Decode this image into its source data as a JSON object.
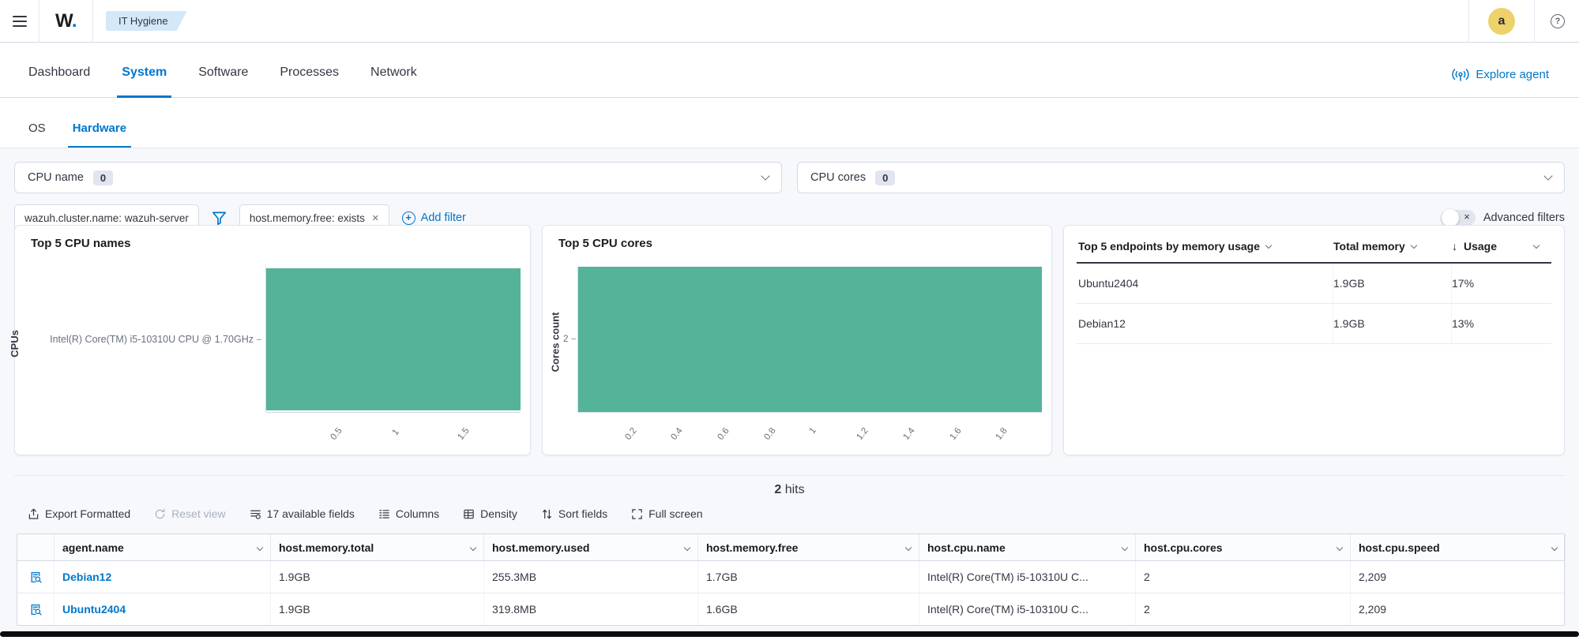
{
  "colors": {
    "accent": "#0077cc",
    "bar": "#54b399",
    "panel_border": "#d3dae6",
    "avatar_bg": "#edd16b"
  },
  "topbar": {
    "logo": "W",
    "logo_dot": ".",
    "badge": "IT Hygiene",
    "avatar_initial": "a",
    "help_glyph": "?"
  },
  "nav": {
    "tabs": [
      {
        "label": "Dashboard"
      },
      {
        "label": "System"
      },
      {
        "label": "Software"
      },
      {
        "label": "Processes"
      },
      {
        "label": "Network"
      }
    ],
    "active": "System",
    "explore_agent": "Explore agent"
  },
  "subnav": {
    "tabs": [
      {
        "label": "OS"
      },
      {
        "label": "Hardware"
      }
    ],
    "active": "Hardware"
  },
  "facets": [
    {
      "label": "CPU name",
      "count": "0"
    },
    {
      "label": "CPU cores",
      "count": "0"
    }
  ],
  "filter_bar": {
    "pinned_filter": "wazuh.cluster.name: wazuh-server",
    "filter": "host.memory.free: exists",
    "remove_glyph": "×",
    "add_filter": "Add filter",
    "advanced_label": "Advanced filters",
    "toggle_off_glyph": "×"
  },
  "chart_data": [
    {
      "type": "bar",
      "orientation": "horizontal",
      "title": "Top 5 CPU names",
      "axis_label": "CPUs",
      "categories": [
        "Intel(R) Core(TM) i5-10310U CPU @ 1.70GHz"
      ],
      "values": [
        2
      ],
      "axis_max": 2,
      "xticks": [
        "0.5",
        "1",
        "1.5"
      ],
      "grid": false,
      "legend": false
    },
    {
      "type": "bar",
      "orientation": "vertical",
      "title": "Top 5 CPU cores",
      "axis_label": "Cores count",
      "categories": [
        "2"
      ],
      "values": [
        2
      ],
      "axis_max": 2,
      "yticks": [
        "2"
      ],
      "xticks": [
        "0.2",
        "0.4",
        "0.6",
        "0.8",
        "1",
        "1.2",
        "1.4",
        "1.6",
        "1.8"
      ],
      "grid": false,
      "legend": false
    },
    {
      "type": "table",
      "title": "Top 5 endpoints by memory usage",
      "columns": [
        "Top 5 endpoints by memory usage",
        "Total memory",
        "Usage"
      ],
      "sort": {
        "column": "Usage",
        "direction": "desc",
        "glyph": "↓"
      },
      "rows": [
        [
          "Ubuntu2404",
          "1.9GB",
          "17%"
        ],
        [
          "Debian12",
          "1.9GB",
          "13%"
        ]
      ]
    }
  ],
  "hits": {
    "count": "2",
    "label": "hits"
  },
  "toolbar": {
    "items": [
      "Export Formatted",
      "Reset view",
      "17 available fields",
      "Columns",
      "Density",
      "Sort fields",
      "Full screen"
    ]
  },
  "grid": {
    "columns": [
      "agent.name",
      "host.memory.total",
      "host.memory.used",
      "host.memory.free",
      "host.cpu.name",
      "host.cpu.cores",
      "host.cpu.speed"
    ],
    "rows": [
      [
        "Debian12",
        "1.9GB",
        "255.3MB",
        "1.7GB",
        "Intel(R) Core(TM) i5-10310U C...",
        "2",
        "2,209"
      ],
      [
        "Ubuntu2404",
        "1.9GB",
        "319.8MB",
        "1.6GB",
        "Intel(R) Core(TM) i5-10310U C...",
        "2",
        "2,209"
      ]
    ]
  }
}
